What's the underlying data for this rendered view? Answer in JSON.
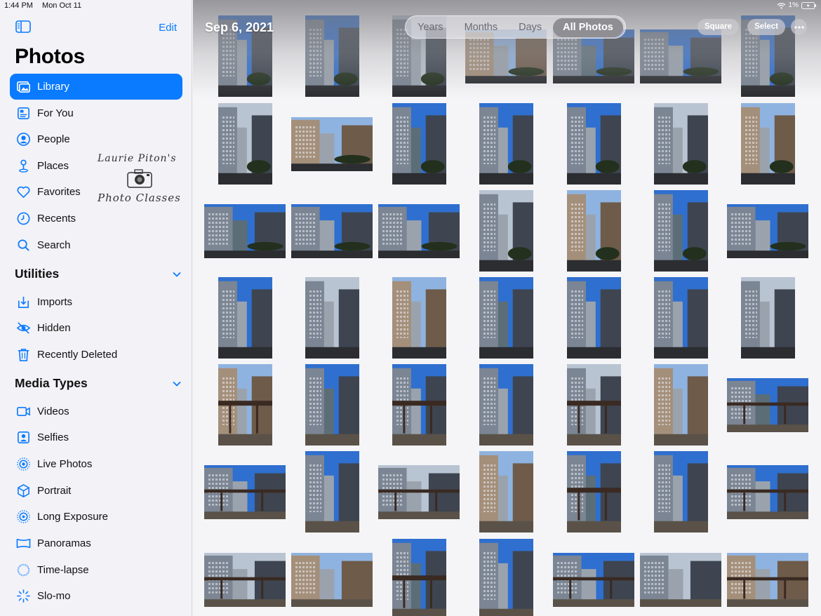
{
  "status": {
    "time": "1:44 PM",
    "date": "Mon Oct 11",
    "battery": "1%"
  },
  "sidebar": {
    "edit_label": "Edit",
    "title": "Photos",
    "items": [
      {
        "label": "Library",
        "icon": "library-icon"
      },
      {
        "label": "For You",
        "icon": "for-you-icon"
      },
      {
        "label": "People",
        "icon": "people-icon"
      },
      {
        "label": "Places",
        "icon": "places-icon"
      },
      {
        "label": "Favorites",
        "icon": "heart-icon"
      },
      {
        "label": "Recents",
        "icon": "clock-icon"
      },
      {
        "label": "Search",
        "icon": "search-icon"
      }
    ],
    "utilities": {
      "title": "Utilities",
      "items": [
        {
          "label": "Imports",
          "icon": "imports-icon"
        },
        {
          "label": "Hidden",
          "icon": "hidden-eye-icon"
        },
        {
          "label": "Recently Deleted",
          "icon": "trash-icon"
        }
      ]
    },
    "media_types": {
      "title": "Media Types",
      "items": [
        {
          "label": "Videos",
          "icon": "video-icon"
        },
        {
          "label": "Selfies",
          "icon": "selfie-icon"
        },
        {
          "label": "Live Photos",
          "icon": "live-photo-icon"
        },
        {
          "label": "Portrait",
          "icon": "portrait-cube-icon"
        },
        {
          "label": "Long Exposure",
          "icon": "long-exposure-icon"
        },
        {
          "label": "Panoramas",
          "icon": "panorama-icon"
        },
        {
          "label": "Time-lapse",
          "icon": "timelapse-icon"
        },
        {
          "label": "Slo-mo",
          "icon": "slomo-icon"
        }
      ]
    },
    "watermark": {
      "line1": "Laurie Piton's",
      "line2": "Photo Classes"
    }
  },
  "main": {
    "date_title": "Sep 6, 2021",
    "view_tabs": [
      "Years",
      "Months",
      "Days",
      "All Photos"
    ],
    "active_tab": "All Photos",
    "square_label": "Square",
    "select_label": "Select"
  },
  "colors": {
    "accent": "#0a7aff",
    "sidebar_bg": "#f2f2f7"
  }
}
